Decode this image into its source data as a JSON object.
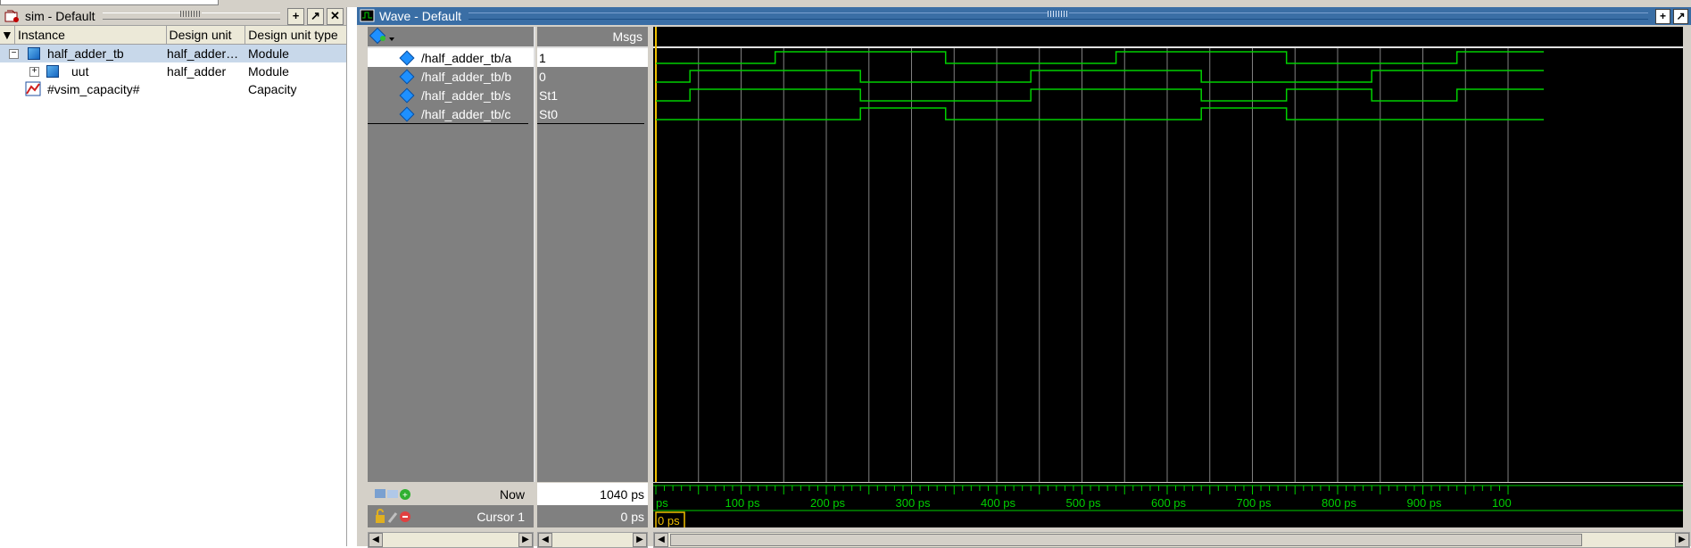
{
  "sim_pane": {
    "title": "sim - Default",
    "columns": [
      "Instance",
      "Design unit",
      "Design unit type"
    ],
    "rows": [
      {
        "instance": "half_adder_tb",
        "design_unit": "half_adder…",
        "type": "Module"
      },
      {
        "instance": "uut",
        "design_unit": "half_adder",
        "type": "Module"
      },
      {
        "instance": "#vsim_capacity#",
        "design_unit": "",
        "type": "Capacity"
      }
    ]
  },
  "wave_pane": {
    "title": "Wave - Default",
    "msgs_header": "Msgs",
    "signals": [
      {
        "name": "/half_adder_tb/a",
        "value": "1"
      },
      {
        "name": "/half_adder_tb/b",
        "value": "0"
      },
      {
        "name": "/half_adder_tb/s",
        "value": "St1"
      },
      {
        "name": "/half_adder_tb/c",
        "value": "St0"
      }
    ],
    "now_label": "Now",
    "now_value": "1040 ps",
    "cursor_label": "Cursor 1",
    "cursor_value": "0 ps",
    "cursor_tag": "0 ps",
    "ruler_labels": [
      "ps",
      "100 ps",
      "200 ps",
      "300 ps",
      "400 ps",
      "500 ps",
      "600 ps",
      "700 ps",
      "800 ps",
      "900 ps",
      "100"
    ]
  },
  "colors": {
    "wave": "#00d000",
    "cursor": "#f0c000",
    "grid": "#808080",
    "selected_row": "#c8d8ea"
  },
  "icons": [
    "sim-icon",
    "wave-icon",
    "plus-icon",
    "undock-icon",
    "close-icon",
    "cube-icon",
    "capacity-icon",
    "diamond-icon"
  ],
  "chart_data": {
    "type": "line",
    "x_unit": "ps",
    "xlim": [
      0,
      1000
    ],
    "series": [
      {
        "name": "/half_adder_tb/a",
        "t": [
          0,
          140,
          340,
          540,
          740,
          940
        ],
        "values": [
          0,
          1,
          0,
          1,
          0,
          1
        ]
      },
      {
        "name": "/half_adder_tb/b",
        "t": [
          0,
          40,
          240,
          440,
          640,
          840
        ],
        "values": [
          0,
          1,
          0,
          1,
          0,
          1
        ]
      },
      {
        "name": "/half_adder_tb/s",
        "t": [
          0,
          40,
          240,
          440,
          640,
          740,
          840,
          940
        ],
        "values": [
          0,
          1,
          0,
          1,
          0,
          1,
          0,
          1
        ]
      },
      {
        "name": "/half_adder_tb/c",
        "t": [
          0,
          240,
          340,
          640,
          740
        ],
        "values": [
          0,
          1,
          0,
          1,
          0
        ]
      }
    ]
  }
}
